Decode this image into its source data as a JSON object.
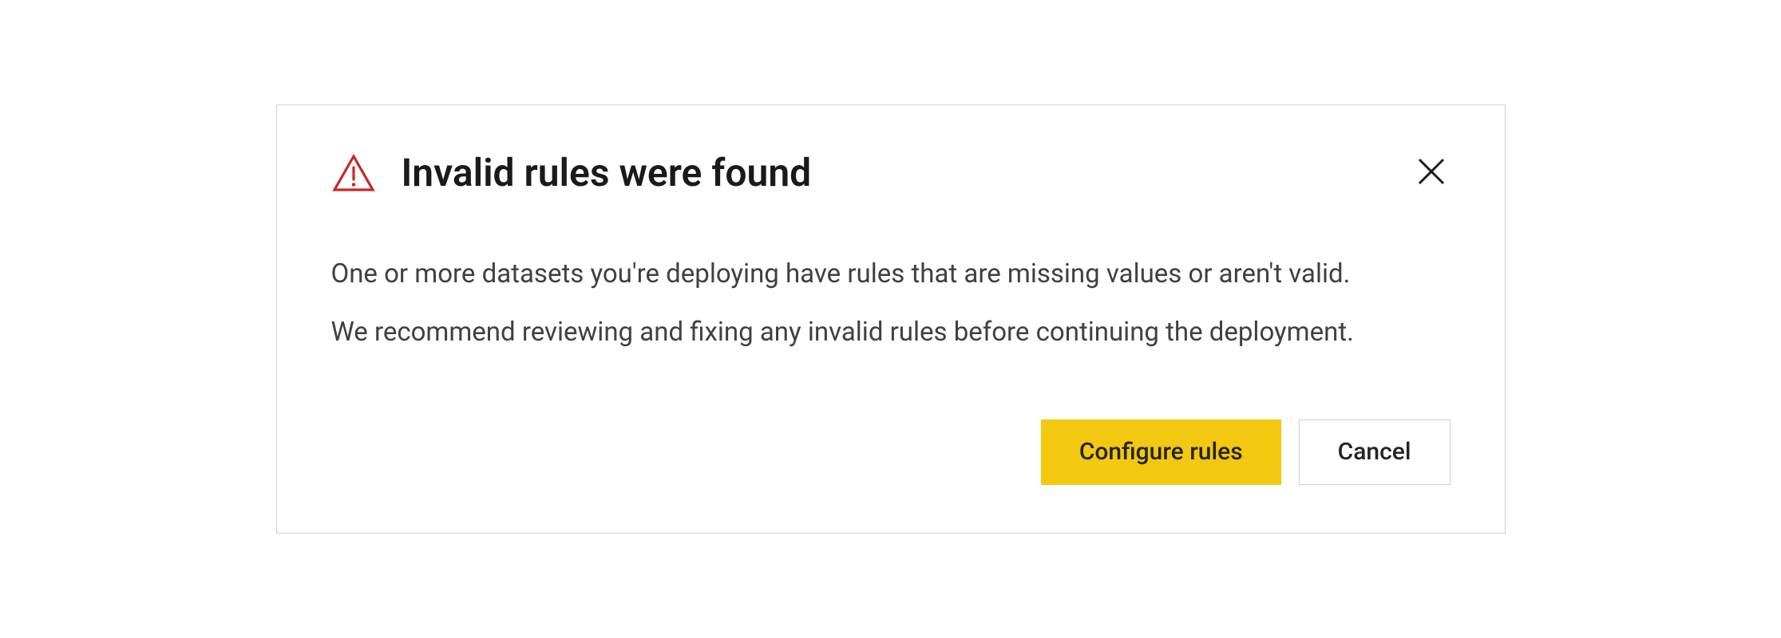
{
  "dialog": {
    "title": "Invalid rules were found",
    "body_line1": "One or more datasets you're deploying have rules that are missing values or aren't valid.",
    "body_line2": "We recommend reviewing and fixing any invalid rules before continuing the deployment.",
    "primary_button": "Configure rules",
    "secondary_button": "Cancel"
  },
  "icons": {
    "warning": "warning-triangle",
    "close": "close-x"
  },
  "colors": {
    "warning_icon": "#c62828",
    "primary_button_bg": "#f2c811",
    "title_text": "#1a1a1a",
    "body_text": "#404040"
  }
}
